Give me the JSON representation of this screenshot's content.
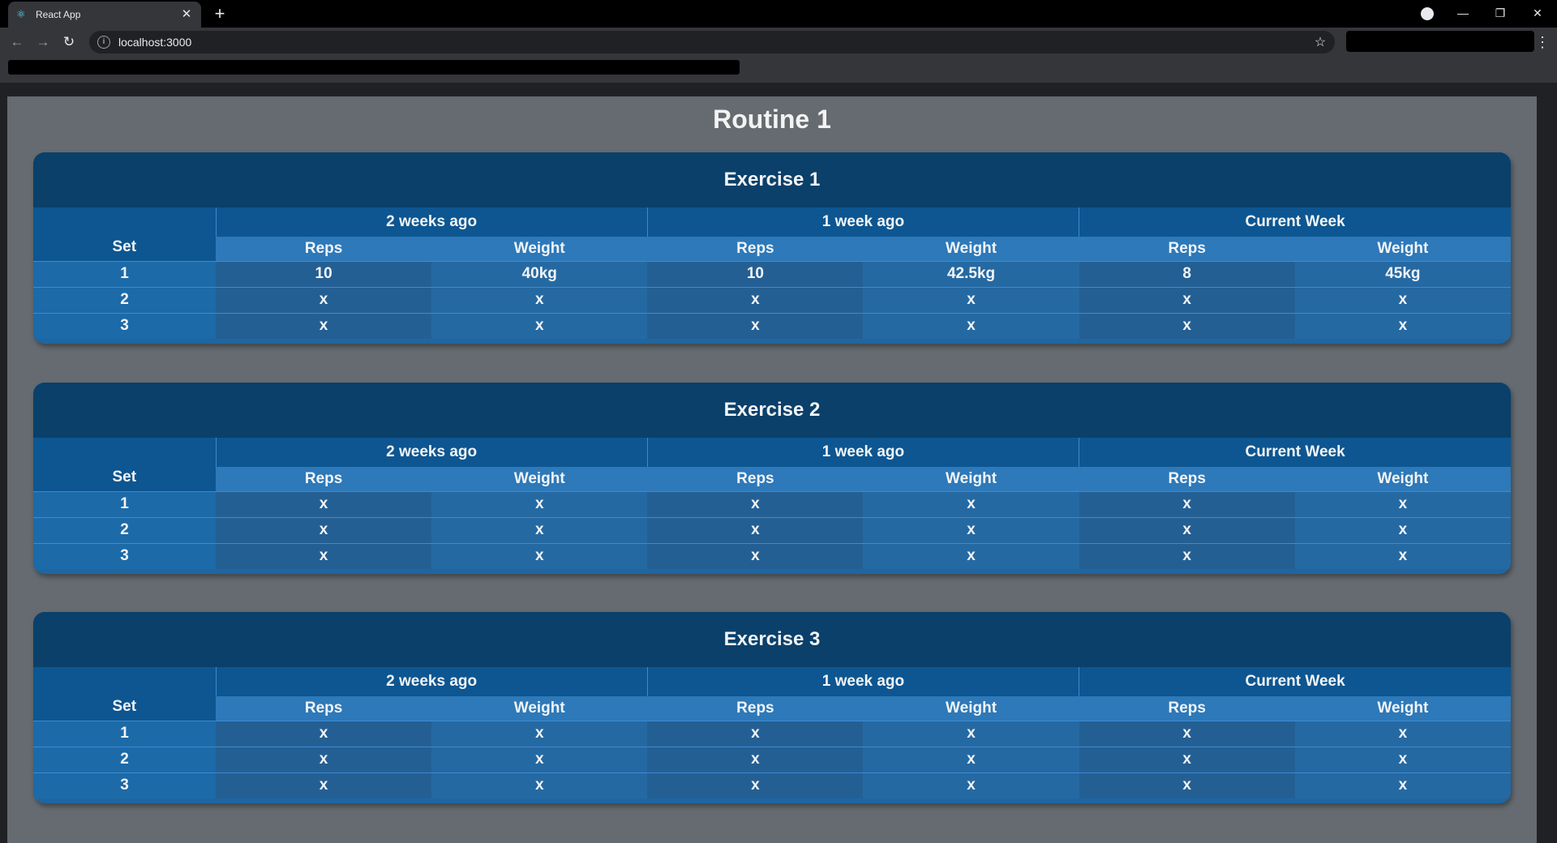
{
  "browser": {
    "tab_title": "React App",
    "tab_close": "✕",
    "new_tab": "+",
    "url": "localhost:3000"
  },
  "page": {
    "title": "Routine 1",
    "set_label": "Set",
    "periods": [
      "2 weeks ago",
      "1 week ago",
      "Current Week"
    ],
    "sub_headers": [
      "Reps",
      "Weight"
    ],
    "exercises": [
      {
        "name": "Exercise 1",
        "rows": [
          {
            "set": "1",
            "cells": [
              "10",
              "40kg",
              "10",
              "42.5kg",
              "8",
              "45kg"
            ]
          },
          {
            "set": "2",
            "cells": [
              "x",
              "x",
              "x",
              "x",
              "x",
              "x"
            ]
          },
          {
            "set": "3",
            "cells": [
              "x",
              "x",
              "x",
              "x",
              "x",
              "x"
            ]
          }
        ]
      },
      {
        "name": "Exercise 2",
        "rows": [
          {
            "set": "1",
            "cells": [
              "x",
              "x",
              "x",
              "x",
              "x",
              "x"
            ]
          },
          {
            "set": "2",
            "cells": [
              "x",
              "x",
              "x",
              "x",
              "x",
              "x"
            ]
          },
          {
            "set": "3",
            "cells": [
              "x",
              "x",
              "x",
              "x",
              "x",
              "x"
            ]
          }
        ]
      },
      {
        "name": "Exercise 3",
        "rows": [
          {
            "set": "1",
            "cells": [
              "x",
              "x",
              "x",
              "x",
              "x",
              "x"
            ]
          },
          {
            "set": "2",
            "cells": [
              "x",
              "x",
              "x",
              "x",
              "x",
              "x"
            ]
          },
          {
            "set": "3",
            "cells": [
              "x",
              "x",
              "x",
              "x",
              "x",
              "x"
            ]
          }
        ]
      }
    ]
  },
  "colors": {
    "page_bg": "#656b70",
    "header_dark": "#0a406a",
    "header_mid": "#0d5691",
    "header_light": "#2d79b9",
    "cell": "#245f94"
  }
}
